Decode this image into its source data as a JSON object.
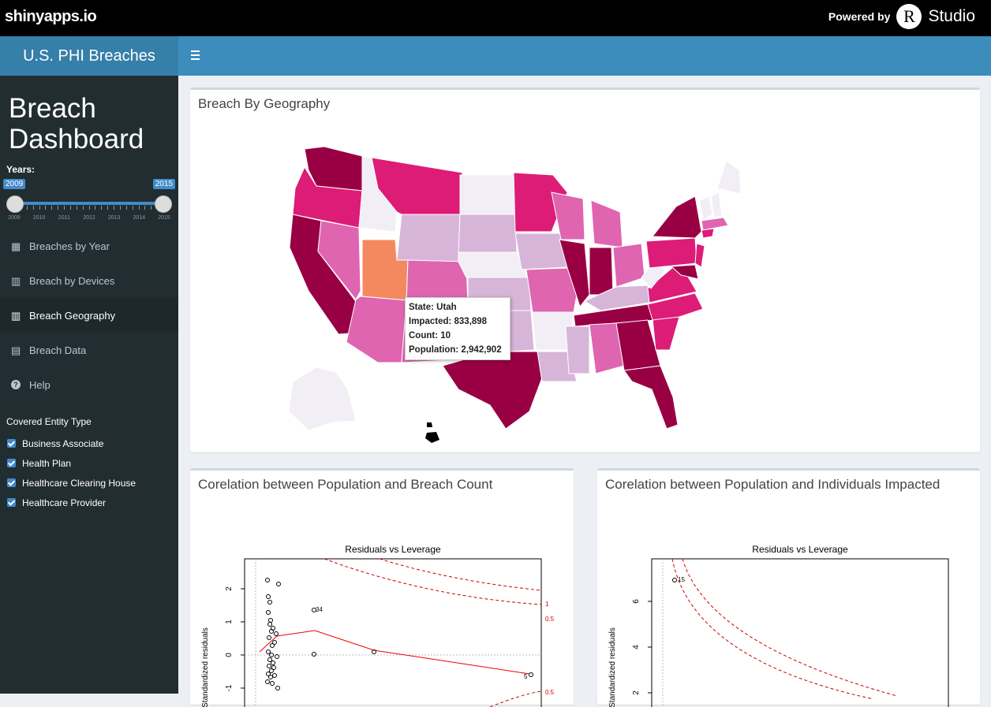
{
  "topbar": {
    "brand": "shinyapps.io",
    "powered_by": "Powered by",
    "r_letter": "R",
    "studio": "Studio"
  },
  "sidebar": {
    "app_title": "U.S. PHI Breaches",
    "dashboard_title": "Breach Dashboard",
    "years_label": "Years:",
    "slider": {
      "min": "2009",
      "max": "2015",
      "from": "2009",
      "to": "2015",
      "tick_labels": [
        "2009",
        "2010",
        "2011",
        "2012",
        "2013",
        "2014",
        "2015"
      ]
    },
    "menu": [
      {
        "label": "Breaches by Year",
        "icon": "calendar-icon"
      },
      {
        "label": "Breach by Devices",
        "icon": "map-icon"
      },
      {
        "label": "Breach Geography",
        "icon": "map-icon",
        "active": true
      },
      {
        "label": "Breach Data",
        "icon": "table-icon"
      },
      {
        "label": "Help",
        "icon": "question-circle-icon"
      }
    ],
    "entity_label": "Covered Entity Type",
    "entity_types": [
      {
        "label": "Business Associate",
        "checked": true
      },
      {
        "label": "Health Plan",
        "checked": true
      },
      {
        "label": "Healthcare Clearing House",
        "checked": true
      },
      {
        "label": "Healthcare Provider",
        "checked": true
      }
    ]
  },
  "map_box": {
    "title": "Breach By Geography",
    "tooltip": {
      "state": "State: Utah",
      "impacted": "Impacted: 833,898",
      "count": "Count: 10",
      "population": "Population: 2,942,902"
    }
  },
  "plot1": {
    "title": "Corelation between Population and Breach Count",
    "chart_title": "Residuals vs Leverage",
    "ylabel": "Standardized residuals",
    "yticks": [
      "2",
      "1",
      "0",
      "-1"
    ],
    "point_label_a": "34",
    "point_label_b": "5",
    "contour_1": "1",
    "contour_05": "0.5",
    "contour_05b": "0.5"
  },
  "plot2": {
    "title": "Corelation between Population and Individuals Impacted",
    "chart_title": "Residuals vs Leverage",
    "ylabel": "Standardized residuals",
    "yticks": [
      "6",
      "4",
      "2"
    ],
    "point_label": "15"
  },
  "colors": {
    "top": "#000000",
    "header": "#3c8dbc",
    "sidebar": "#222d32",
    "accent": "#428bca",
    "map_high": "#980043",
    "map_mid": "#dd1c77",
    "map_low": "#d7b5d8",
    "highlight": "#f4895f"
  }
}
